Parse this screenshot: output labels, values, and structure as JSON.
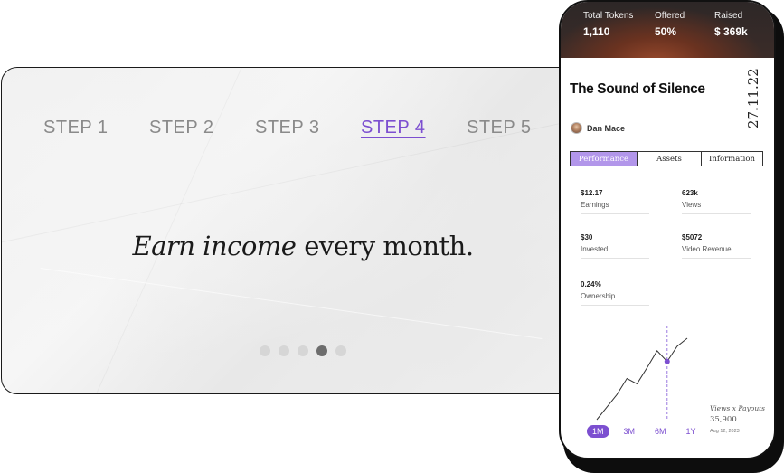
{
  "steps": [
    {
      "label": "STEP 1",
      "active": false
    },
    {
      "label": "STEP 2",
      "active": false
    },
    {
      "label": "STEP 3",
      "active": false
    },
    {
      "label": "STEP 4",
      "active": true
    },
    {
      "label": "STEP 5",
      "active": false
    }
  ],
  "headline": {
    "emphasis": "Earn income",
    "rest": " every month."
  },
  "pagination": {
    "total": 5,
    "active_index": 3
  },
  "phone": {
    "stats": [
      {
        "label": "Total Tokens",
        "value": "1,110"
      },
      {
        "label": "Offered",
        "value": "50%"
      },
      {
        "label": "Raised",
        "value": "$ 369k"
      }
    ],
    "title": "The Sound of Silence",
    "date": "27.11.22",
    "author": "Dan Mace",
    "tabs": [
      {
        "label": "Performance",
        "active": true
      },
      {
        "label": "Assets",
        "active": false
      },
      {
        "label": "Information",
        "active": false
      }
    ],
    "metrics": [
      {
        "value": "$12.17",
        "label": "Earnings"
      },
      {
        "value": "623k",
        "label": "Views"
      },
      {
        "value": "$30",
        "label": "Invested"
      },
      {
        "value": "$5072",
        "label": "Video Revenue"
      },
      {
        "value": "0.24%",
        "label": "Ownership"
      }
    ],
    "chart": {
      "legend_title": "Views x  Payouts",
      "value": "35,900",
      "date": "Aug 12, 2023",
      "line": [
        0,
        14,
        28,
        46,
        40,
        58,
        77,
        65,
        82,
        91
      ]
    },
    "ranges": [
      {
        "label": "1M",
        "active": true
      },
      {
        "label": "3M",
        "active": false
      },
      {
        "label": "6M",
        "active": false
      },
      {
        "label": "1Y",
        "active": false
      }
    ],
    "colors": {
      "accent": "#7c4fd0",
      "tab_active": "#b296ea"
    }
  }
}
